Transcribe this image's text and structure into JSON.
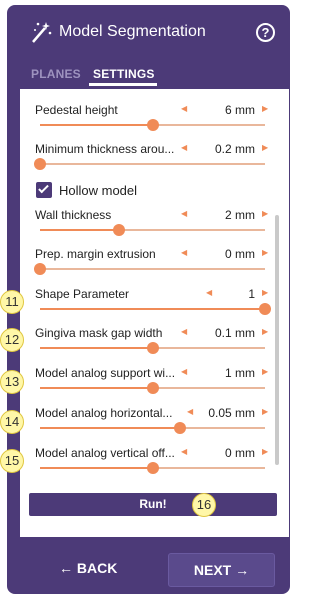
{
  "header": {
    "title": "Model Segmentation",
    "help_symbol": "?"
  },
  "tabs": [
    {
      "label": "PLANES",
      "active": false
    },
    {
      "label": "SETTINGS",
      "active": true
    }
  ],
  "settings": [
    {
      "label": "Pedestal height",
      "value": "6 mm",
      "level": 0.5
    },
    {
      "label": "Minimum thickness arou...",
      "value": "0.2 mm",
      "level": 0.0
    },
    {
      "label": "Wall thickness",
      "value": "2 mm",
      "level": 0.35
    },
    {
      "label": "Prep. margin extrusion",
      "value": "0 mm",
      "level": 0.0
    },
    {
      "label": "Shape Parameter",
      "value": "1",
      "level": 1.0
    },
    {
      "label": "Gingiva mask gap width",
      "value": "0.1 mm",
      "level": 0.5
    },
    {
      "label": "Model analog support wi...",
      "value": "1 mm",
      "level": 0.5
    },
    {
      "label": "Model analog horizontal...",
      "value": "0.05 mm",
      "level": 0.62
    },
    {
      "label": "Model analog vertical off...",
      "value": "0 mm",
      "level": 0.5
    }
  ],
  "hollow_model": {
    "label": "Hollow model",
    "checked": true
  },
  "callouts": [
    "11",
    "12",
    "13",
    "14",
    "15",
    "16"
  ],
  "run_button": "Run!",
  "nav": {
    "back_label": "BACK",
    "next_label": "NEXT"
  },
  "colors": {
    "panel": "#4c3a78",
    "accent": "#f08b57",
    "callout": "#fff7a8"
  }
}
